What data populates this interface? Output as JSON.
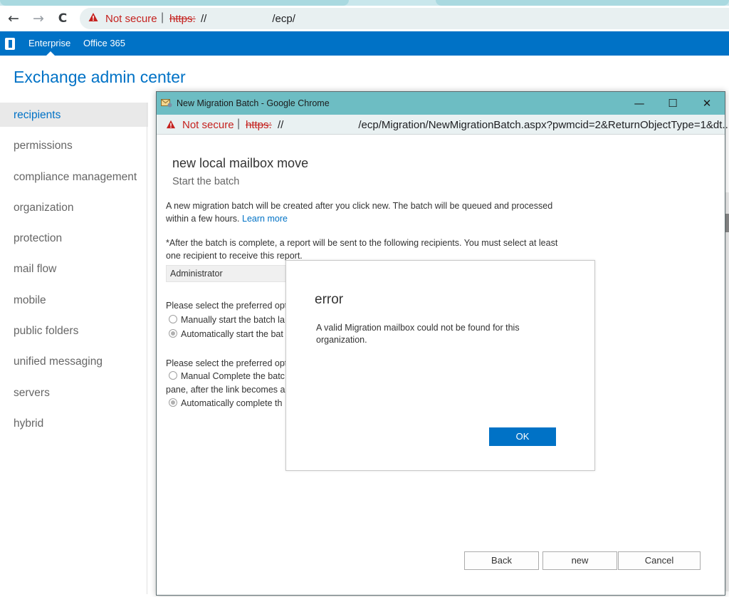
{
  "browser": {
    "not_secure": "Not secure",
    "url_scheme": "https:",
    "url_prefix": "//",
    "url_rest": "/ecp/",
    "icons": {
      "back": "arrow-left-icon",
      "forward": "arrow-right-icon",
      "reload": "reload-icon",
      "warning": "warning-triangle-icon"
    }
  },
  "o365bar": {
    "enterprise": "Enterprise",
    "office365": "Office 365",
    "color": "#0072c6"
  },
  "eac": {
    "title": "Exchange admin center",
    "nav": [
      "recipients",
      "permissions",
      "compliance management",
      "organization",
      "protection",
      "mail flow",
      "mobile",
      "public folders",
      "unified messaging",
      "servers",
      "hybrid"
    ],
    "selected_index": 0
  },
  "popup": {
    "window_title": "New Migration Batch - Google Chrome",
    "controls": {
      "minimize": "—",
      "maximize": "☐",
      "close": "✕"
    },
    "not_secure": "Not secure",
    "url_scheme": "https:",
    "url_prefix": "//",
    "url_rest": "/ecp/Migration/NewMigrationBatch.aspx?pwmcid=2&ReturnObjectType=1&dt...",
    "heading": "new local mailbox move",
    "subheading": "Start the batch",
    "intro_text": "A new migration batch will be created after you click new. The batch will be queued and processed within a few hours.",
    "learn_more": "Learn more",
    "report_text": "*After the batch is complete, a report will be sent to the following recipients. You must select at least one recipient to receive this report.",
    "recipient": "Administrator",
    "start_prompt": "Please select the preferred opt",
    "start_manual": "Manually start the batch la",
    "start_auto": "Automatically start the bat",
    "complete_prompt": "Please select the preferred opt",
    "complete_manual": "Manual Complete the batc",
    "complete_pane": "pane, after the link becomes a",
    "complete_auto": "Automatically complete th",
    "buttons": {
      "back": "Back",
      "new": "new",
      "cancel": "Cancel"
    }
  },
  "error_dialog": {
    "title": "error",
    "message": "A valid Migration mailbox could not be found for this organization.",
    "ok": "OK"
  }
}
